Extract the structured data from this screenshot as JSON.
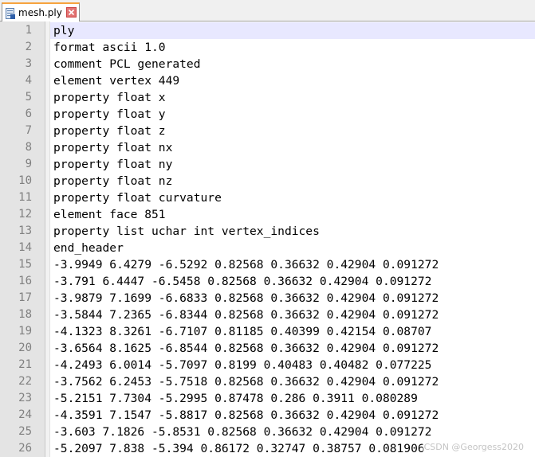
{
  "tab": {
    "title": "mesh.ply",
    "close_icon": "close-icon",
    "file_icon": "file-icon"
  },
  "colors": {
    "current_line": "#e8e8ff",
    "gutter": "#e4e4e4",
    "tab_accent": "#f6a33e",
    "close_button": "#e27373"
  },
  "current_line_index": 0,
  "lines": [
    {
      "num": "1",
      "text": "ply"
    },
    {
      "num": "2",
      "text": "format ascii 1.0"
    },
    {
      "num": "3",
      "text": "comment PCL generated"
    },
    {
      "num": "4",
      "text": "element vertex 449"
    },
    {
      "num": "5",
      "text": "property float x"
    },
    {
      "num": "6",
      "text": "property float y"
    },
    {
      "num": "7",
      "text": "property float z"
    },
    {
      "num": "8",
      "text": "property float nx"
    },
    {
      "num": "9",
      "text": "property float ny"
    },
    {
      "num": "10",
      "text": "property float nz"
    },
    {
      "num": "11",
      "text": "property float curvature"
    },
    {
      "num": "12",
      "text": "element face 851"
    },
    {
      "num": "13",
      "text": "property list uchar int vertex_indices"
    },
    {
      "num": "14",
      "text": "end_header"
    },
    {
      "num": "15",
      "text": "-3.9949 6.4279 -6.5292 0.82568 0.36632 0.42904 0.091272"
    },
    {
      "num": "16",
      "text": "-3.791 6.4447 -6.5458 0.82568 0.36632 0.42904 0.091272"
    },
    {
      "num": "17",
      "text": "-3.9879 7.1699 -6.6833 0.82568 0.36632 0.42904 0.091272"
    },
    {
      "num": "18",
      "text": "-3.5844 7.2365 -6.8344 0.82568 0.36632 0.42904 0.091272"
    },
    {
      "num": "19",
      "text": "-4.1323 8.3261 -6.7107 0.81185 0.40399 0.42154 0.08707"
    },
    {
      "num": "20",
      "text": "-3.6564 8.1625 -6.8544 0.82568 0.36632 0.42904 0.091272"
    },
    {
      "num": "21",
      "text": "-4.2493 6.0014 -5.7097 0.8199 0.40483 0.40482 0.077225"
    },
    {
      "num": "22",
      "text": "-3.7562 6.2453 -5.7518 0.82568 0.36632 0.42904 0.091272"
    },
    {
      "num": "23",
      "text": "-5.2151 7.7304 -5.2995 0.87478 0.286 0.3911 0.080289"
    },
    {
      "num": "24",
      "text": "-4.3591 7.1547 -5.8817 0.82568 0.36632 0.42904 0.091272"
    },
    {
      "num": "25",
      "text": "-3.603 7.1826 -5.8531 0.82568 0.36632 0.42904 0.091272"
    },
    {
      "num": "26",
      "text": "-5.2097 7.838 -5.394 0.86172 0.32747 0.38757 0.081906"
    }
  ],
  "watermark": "CSDN @Georgess2020"
}
